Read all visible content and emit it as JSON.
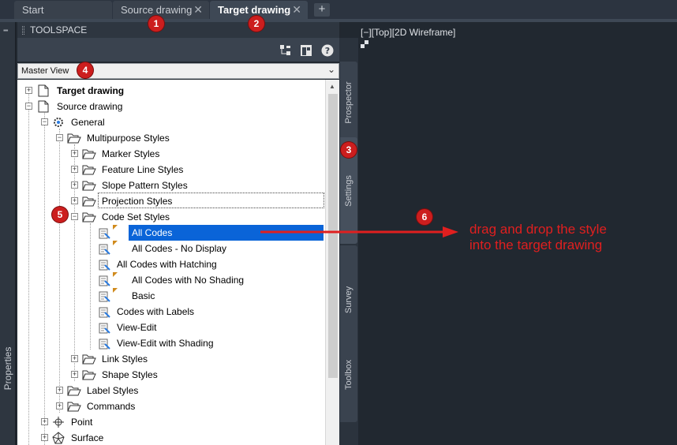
{
  "tabs": [
    {
      "label": "Start"
    },
    {
      "label": "Source drawing",
      "close": "✕"
    },
    {
      "label": "Target drawing",
      "close": "✕"
    }
  ],
  "add_tab": "+",
  "toolspace": {
    "title": "TOOLSPACE"
  },
  "properties_label": "Properties",
  "view_select": {
    "value": "Master View"
  },
  "tree": [
    {
      "label": "Target drawing",
      "bold": true
    },
    {
      "label": "Source drawing"
    },
    {
      "label": "General"
    },
    {
      "label": "Multipurpose Styles"
    },
    {
      "label": "Marker Styles"
    },
    {
      "label": "Feature Line Styles"
    },
    {
      "label": "Slope Pattern Styles"
    },
    {
      "label": "Projection Styles"
    },
    {
      "label": "Code Set Styles"
    },
    {
      "label": "All Codes"
    },
    {
      "label": "All Codes - No Display"
    },
    {
      "label": "All Codes with Hatching"
    },
    {
      "label": "All Codes with No Shading"
    },
    {
      "label": "Basic"
    },
    {
      "label": "Codes with Labels"
    },
    {
      "label": "View-Edit"
    },
    {
      "label": "View-Edit with Shading"
    },
    {
      "label": "Link Styles"
    },
    {
      "label": "Shape Styles"
    },
    {
      "label": "Label Styles"
    },
    {
      "label": "Commands"
    },
    {
      "label": "Point"
    },
    {
      "label": "Surface"
    }
  ],
  "vertical_tabs": [
    "Prospector",
    "Settings",
    "Survey",
    "Toolbox"
  ],
  "viewport": {
    "label": "[−][Top][2D Wireframe]"
  },
  "badges": [
    "1",
    "2",
    "3",
    "4",
    "5",
    "6"
  ],
  "callout": {
    "line1": "drag and drop the style",
    "line2": "into the target drawing"
  },
  "colors": {
    "annotation_red": "#e01f1f",
    "selection_blue": "#0a64d8",
    "background": "#212830"
  }
}
